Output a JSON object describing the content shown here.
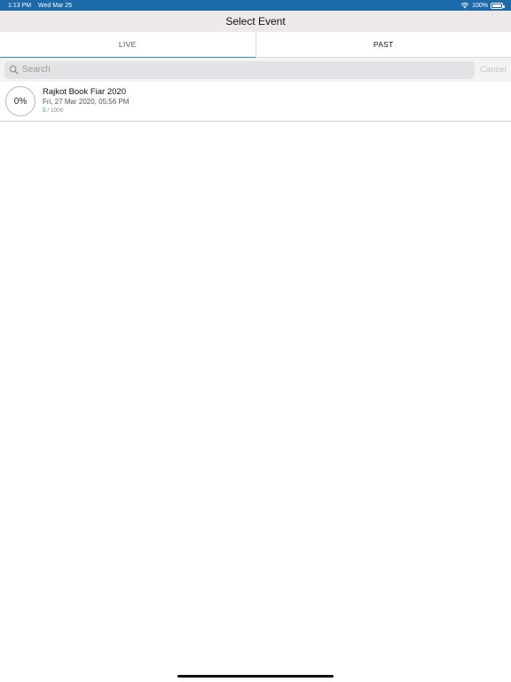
{
  "status_bar": {
    "time": "1:13 PM",
    "date": "Wed Mar 25",
    "battery_percent": "100%",
    "battery_level": 1.0,
    "icons": [
      "wifi-icon",
      "battery-icon"
    ],
    "background_color": "#1d6aab"
  },
  "nav": {
    "title": "Select Event"
  },
  "tabs": [
    {
      "label": "LIVE",
      "selected": true
    },
    {
      "label": "PAST",
      "selected": false
    }
  ],
  "search": {
    "placeholder": "Search",
    "value": "",
    "cancel_label": "Cancel"
  },
  "events": [
    {
      "progress": "0%",
      "progress_value": 0,
      "name": "Rajkot Book Fiar 2020",
      "date": "Fri, 27 Mar 2020, 05:56 PM",
      "count_current": "5",
      "count_separator": " / ",
      "count_total": "1000"
    }
  ],
  "colors": {
    "accent": "#1f8fc4",
    "nav_background": "#ede9ea"
  }
}
